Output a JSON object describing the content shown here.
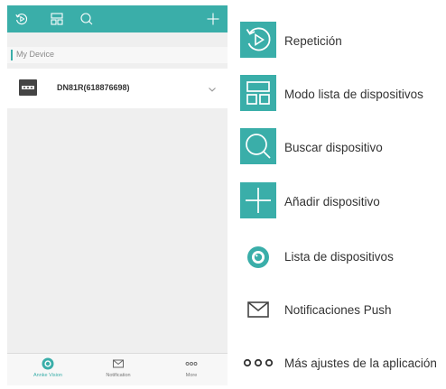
{
  "app": {
    "section_label": "My Device",
    "device": {
      "name": "DN81R(618876698)"
    },
    "tabs": [
      {
        "label": "Annke Vision",
        "icon": "camera-lens-icon",
        "active": true
      },
      {
        "label": "Notification",
        "icon": "envelope-icon",
        "active": false
      },
      {
        "label": "More",
        "icon": "more-dots-icon",
        "active": false
      }
    ]
  },
  "legend": [
    {
      "icon": "playback-icon",
      "text": "Repetición"
    },
    {
      "icon": "device-list-mode-icon",
      "text": "Modo lista de dispositivos"
    },
    {
      "icon": "search-icon",
      "text": "Buscar dispositivo"
    },
    {
      "icon": "add-icon",
      "text": "Añadir dispositivo"
    },
    {
      "icon": "camera-lens-icon",
      "text": "Lista de dispositivos"
    },
    {
      "icon": "envelope-icon",
      "text": "Notificaciones Push"
    },
    {
      "icon": "more-dots-icon",
      "text": "Más ajustes de la aplicación"
    }
  ],
  "colors": {
    "accent": "#3aaea9",
    "phone_bg": "#efefef"
  }
}
